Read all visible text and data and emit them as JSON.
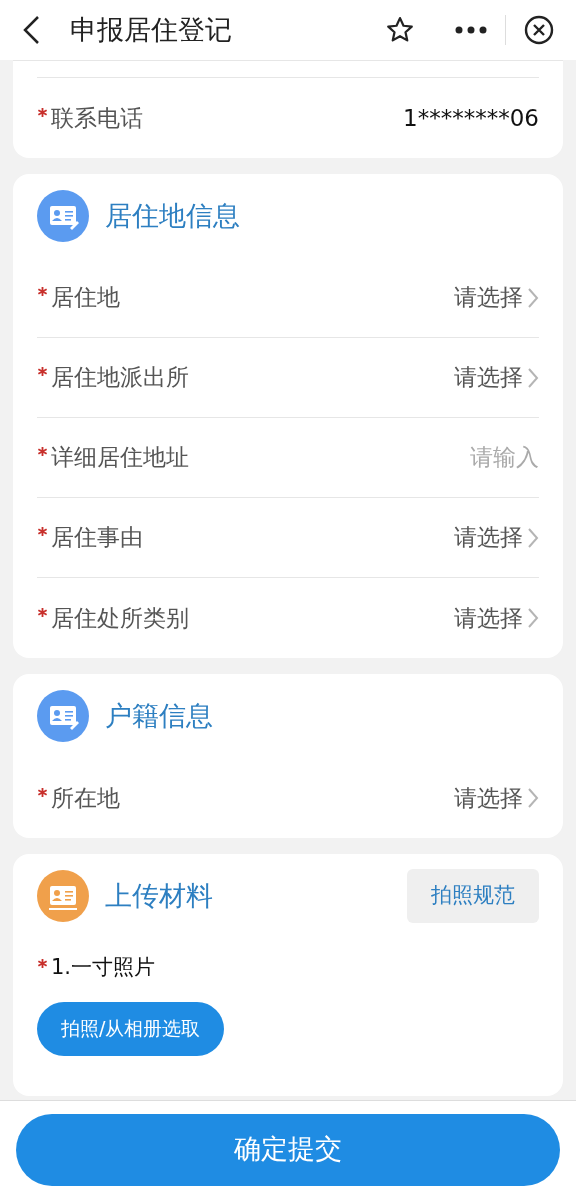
{
  "header": {
    "title": "申报居住登记"
  },
  "contact_card": {
    "fields": [
      {
        "label": "联系电话",
        "required": true,
        "kind": "value",
        "value": "1********06"
      }
    ]
  },
  "sections": [
    {
      "title": "居住地信息",
      "color": "#5b9bf0",
      "fields": [
        {
          "label": "居住地",
          "required": true,
          "kind": "select",
          "value": "请选择"
        },
        {
          "label": "居住地派出所",
          "required": true,
          "kind": "select",
          "value": "请选择"
        },
        {
          "label": "详细居住地址",
          "required": true,
          "kind": "input",
          "placeholder": "请输入"
        },
        {
          "label": "居住事由",
          "required": true,
          "kind": "select",
          "value": "请选择"
        },
        {
          "label": "居住处所类别",
          "required": true,
          "kind": "select",
          "value": "请选择"
        }
      ]
    },
    {
      "title": "户籍信息",
      "color": "#5b9bf0",
      "fields": [
        {
          "label": "所在地",
          "required": true,
          "kind": "select",
          "value": "请选择"
        }
      ]
    }
  ],
  "upload": {
    "title": "上传材料",
    "color": "#f0a04b",
    "guide_button": "拍照规范",
    "items": [
      {
        "label": "1.一寸照片",
        "required": true,
        "button": "拍照/从相册选取"
      }
    ]
  },
  "submit_button": "确定提交"
}
